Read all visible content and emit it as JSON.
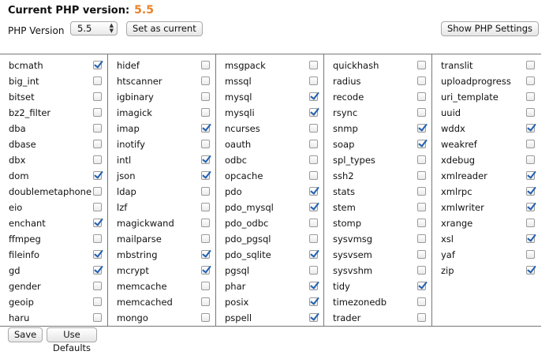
{
  "header": {
    "current_label": "Current PHP version:",
    "current_version": "5.5",
    "php_version_label": "PHP Version",
    "selected_version": "5.5",
    "set_current_label": "Set as current",
    "show_settings_label": "Show PHP Settings"
  },
  "columns": [
    [
      {
        "name": "bcmath",
        "checked": true
      },
      {
        "name": "big_int",
        "checked": false
      },
      {
        "name": "bitset",
        "checked": false
      },
      {
        "name": "bz2_filter",
        "checked": false
      },
      {
        "name": "dba",
        "checked": false
      },
      {
        "name": "dbase",
        "checked": false
      },
      {
        "name": "dbx",
        "checked": false
      },
      {
        "name": "dom",
        "checked": true
      },
      {
        "name": "doublemetaphone",
        "checked": false
      },
      {
        "name": "eio",
        "checked": false
      },
      {
        "name": "enchant",
        "checked": true
      },
      {
        "name": "ffmpeg",
        "checked": false
      },
      {
        "name": "fileinfo",
        "checked": true
      },
      {
        "name": "gd",
        "checked": true
      },
      {
        "name": "gender",
        "checked": false
      },
      {
        "name": "geoip",
        "checked": false
      },
      {
        "name": "haru",
        "checked": false
      }
    ],
    [
      {
        "name": "hidef",
        "checked": false
      },
      {
        "name": "htscanner",
        "checked": false
      },
      {
        "name": "igbinary",
        "checked": false
      },
      {
        "name": "imagick",
        "checked": false
      },
      {
        "name": "imap",
        "checked": true
      },
      {
        "name": "inotify",
        "checked": false
      },
      {
        "name": "intl",
        "checked": true
      },
      {
        "name": "json",
        "checked": true
      },
      {
        "name": "ldap",
        "checked": false
      },
      {
        "name": "lzf",
        "checked": false
      },
      {
        "name": "magickwand",
        "checked": false
      },
      {
        "name": "mailparse",
        "checked": false
      },
      {
        "name": "mbstring",
        "checked": true
      },
      {
        "name": "mcrypt",
        "checked": true
      },
      {
        "name": "memcache",
        "checked": false
      },
      {
        "name": "memcached",
        "checked": false
      },
      {
        "name": "mongo",
        "checked": false
      }
    ],
    [
      {
        "name": "msgpack",
        "checked": false
      },
      {
        "name": "mssql",
        "checked": false
      },
      {
        "name": "mysql",
        "checked": true
      },
      {
        "name": "mysqli",
        "checked": true
      },
      {
        "name": "ncurses",
        "checked": false
      },
      {
        "name": "oauth",
        "checked": false
      },
      {
        "name": "odbc",
        "checked": false
      },
      {
        "name": "opcache",
        "checked": false
      },
      {
        "name": "pdo",
        "checked": true
      },
      {
        "name": "pdo_mysql",
        "checked": true
      },
      {
        "name": "pdo_odbc",
        "checked": false
      },
      {
        "name": "pdo_pgsql",
        "checked": false
      },
      {
        "name": "pdo_sqlite",
        "checked": true
      },
      {
        "name": "pgsql",
        "checked": false
      },
      {
        "name": "phar",
        "checked": true
      },
      {
        "name": "posix",
        "checked": true
      },
      {
        "name": "pspell",
        "checked": true
      }
    ],
    [
      {
        "name": "quickhash",
        "checked": false
      },
      {
        "name": "radius",
        "checked": false
      },
      {
        "name": "recode",
        "checked": false
      },
      {
        "name": "rsync",
        "checked": false
      },
      {
        "name": "snmp",
        "checked": true
      },
      {
        "name": "soap",
        "checked": true
      },
      {
        "name": "spl_types",
        "checked": false
      },
      {
        "name": "ssh2",
        "checked": false
      },
      {
        "name": "stats",
        "checked": false
      },
      {
        "name": "stem",
        "checked": false
      },
      {
        "name": "stomp",
        "checked": false
      },
      {
        "name": "sysvmsg",
        "checked": false
      },
      {
        "name": "sysvsem",
        "checked": false
      },
      {
        "name": "sysvshm",
        "checked": false
      },
      {
        "name": "tidy",
        "checked": true
      },
      {
        "name": "timezonedb",
        "checked": false
      },
      {
        "name": "trader",
        "checked": false
      }
    ],
    [
      {
        "name": "translit",
        "checked": false
      },
      {
        "name": "uploadprogress",
        "checked": false
      },
      {
        "name": "uri_template",
        "checked": false
      },
      {
        "name": "uuid",
        "checked": false
      },
      {
        "name": "wddx",
        "checked": true
      },
      {
        "name": "weakref",
        "checked": false
      },
      {
        "name": "xdebug",
        "checked": false
      },
      {
        "name": "xmlreader",
        "checked": true
      },
      {
        "name": "xmlrpc",
        "checked": true
      },
      {
        "name": "xmlwriter",
        "checked": true
      },
      {
        "name": "xrange",
        "checked": false
      },
      {
        "name": "xsl",
        "checked": true
      },
      {
        "name": "yaf",
        "checked": false
      },
      {
        "name": "zip",
        "checked": true
      }
    ]
  ],
  "footer": {
    "save_label": "Save",
    "defaults_label": "Use Defaults"
  },
  "colors": {
    "version_accent": "#e8832a",
    "check_color": "#1f5fb0"
  }
}
